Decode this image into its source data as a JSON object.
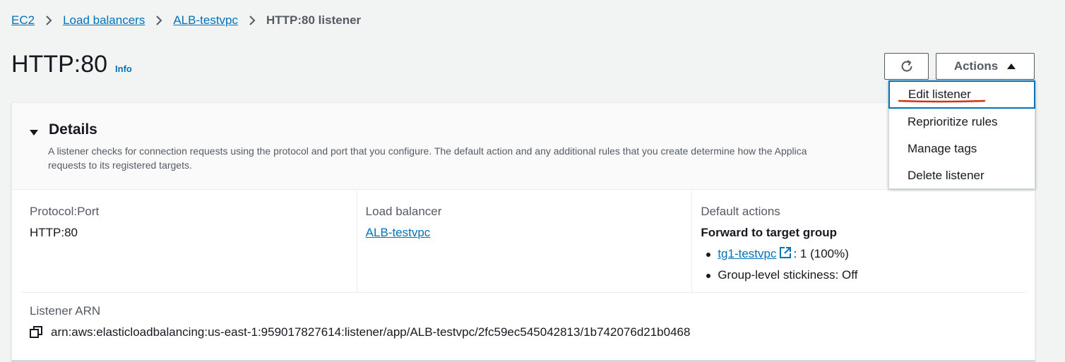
{
  "breadcrumb": {
    "items": [
      "EC2",
      "Load balancers",
      "ALB-testvpc"
    ],
    "current": "HTTP:80 listener"
  },
  "header": {
    "title": "HTTP:80",
    "info": "Info",
    "actions_label": "Actions"
  },
  "details": {
    "title": "Details",
    "description_line1": "A listener checks for connection requests using the protocol and port that you configure. The default action and any additional rules that you create determine how the Applica",
    "description_line2": "requests to its registered targets.",
    "protocol_port_label": "Protocol:Port",
    "protocol_port_value": "HTTP:80",
    "load_balancer_label": "Load balancer",
    "load_balancer_value": "ALB-testvpc",
    "default_actions_label": "Default actions",
    "default_action_type": "Forward to target group",
    "target_group_link": "tg1-testvpc",
    "target_group_weight": ": 1 (100%)",
    "stickiness": "Group-level stickiness: Off",
    "arn_label": "Listener ARN",
    "arn_value": "arn:aws:elasticloadbalancing:us-east-1:959017827614:listener/app/ALB-testvpc/2fc59ec545042813/1b742076d21b0468"
  },
  "actions_menu": {
    "items": [
      "Edit listener",
      "Reprioritize rules",
      "Manage tags",
      "Delete listener"
    ]
  },
  "colors": {
    "link": "#0073bb",
    "annotation": "#d13212"
  }
}
